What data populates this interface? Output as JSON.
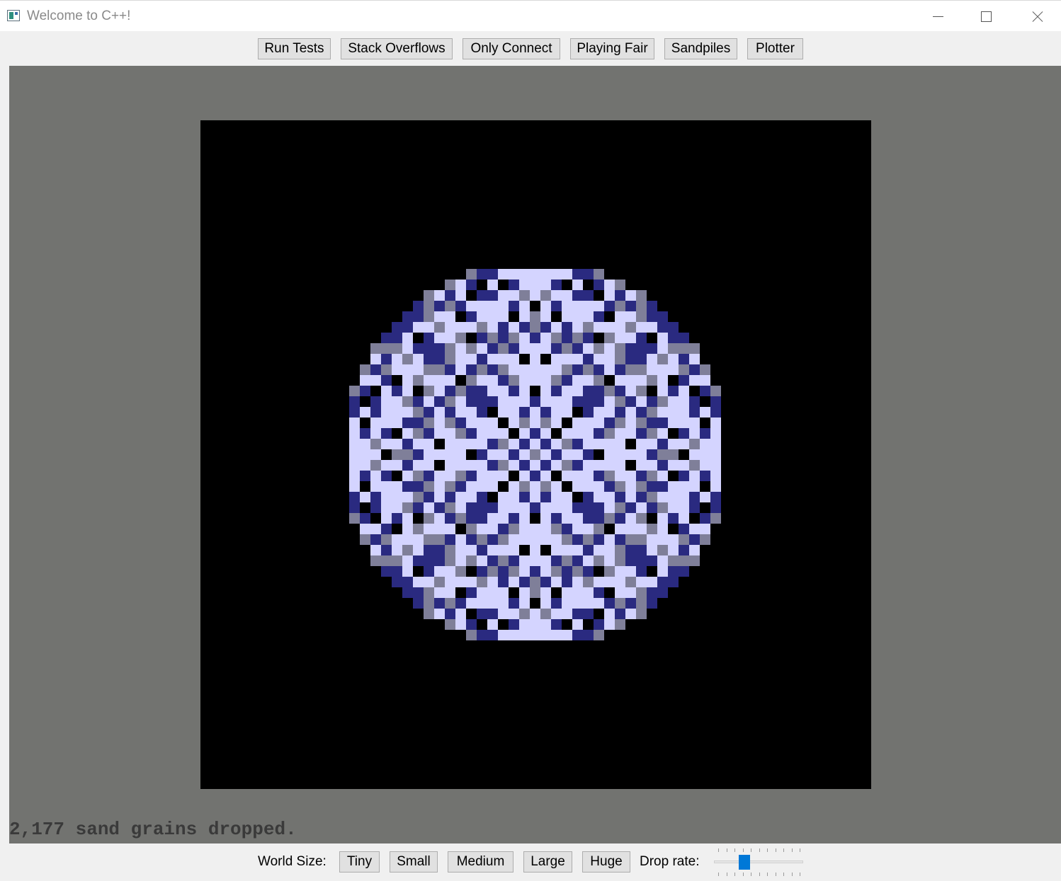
{
  "window": {
    "title": "Welcome to C++!",
    "app_icon": "console-app-icon",
    "controls": [
      "minimize-icon",
      "maximize-icon",
      "close-icon"
    ]
  },
  "top_tabs": [
    {
      "label": "Run Tests"
    },
    {
      "label": "Stack Overflows"
    },
    {
      "label": "Only Connect"
    },
    {
      "label": "Playing Fair"
    },
    {
      "label": "Sandpiles"
    },
    {
      "label": "Plotter"
    }
  ],
  "status_text": "2,177 sand grains dropped.",
  "world_size": {
    "label": "World Size:",
    "options": [
      "Tiny",
      "Small",
      "Medium",
      "Large",
      "Huge"
    ]
  },
  "drop_rate": {
    "label": "Drop rate:",
    "value": 0.32
  },
  "colors": {
    "panel_bg": "#727370",
    "canvas_bg": "#000000",
    "sand_levels": [
      "#000000",
      "#7f7f99",
      "#2a2a80",
      "#d4d4ff"
    ]
  }
}
